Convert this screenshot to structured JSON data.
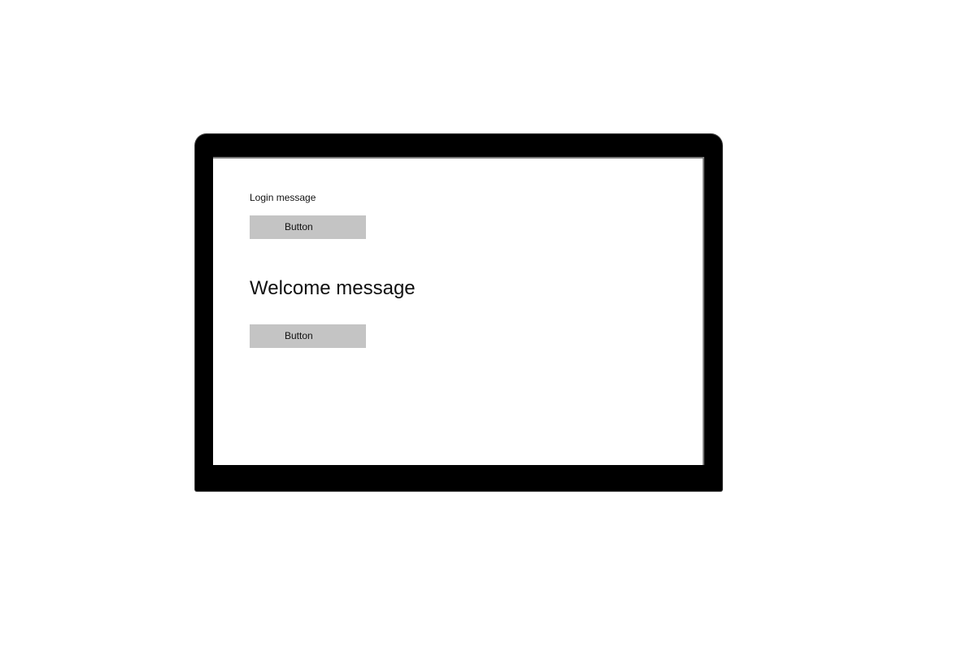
{
  "login": {
    "message": "Login message",
    "button_label": "Button"
  },
  "welcome": {
    "message": "Welcome message",
    "button_label": "Button"
  },
  "colors": {
    "frame": "#000000",
    "screen": "#ffffff",
    "button": "#c4c4c4"
  }
}
